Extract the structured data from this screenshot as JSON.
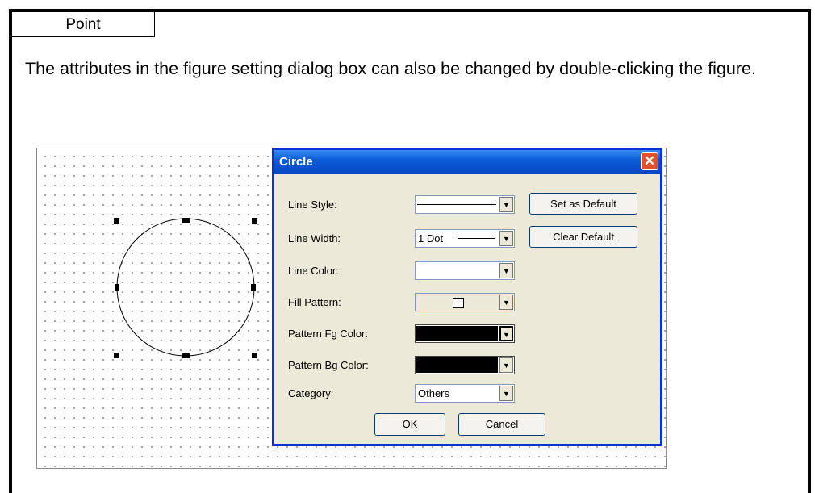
{
  "point_label": "Point",
  "note_text": "The attributes in the figure setting dialog box can also be changed by double-clicking the figure.",
  "dialog": {
    "title": "Circle",
    "close_glyph": "✕",
    "fields": [
      {
        "label": "Line Style:",
        "value": "",
        "kind": "line"
      },
      {
        "label": "Line Width:",
        "value": "1 Dot",
        "kind": "width"
      },
      {
        "label": "Line Color:",
        "value": "",
        "kind": "color",
        "color": "#ffffff"
      },
      {
        "label": "Fill Pattern:",
        "value": "",
        "kind": "pattern"
      },
      {
        "label": "Pattern Fg Color:",
        "value": "",
        "kind": "color",
        "color": "#000000"
      },
      {
        "label": "Pattern Bg Color:",
        "value": "",
        "kind": "color",
        "color": "#000000"
      },
      {
        "label": "Category:",
        "value": "Others",
        "kind": "text"
      }
    ],
    "set_default_label": "Set as Default",
    "clear_default_label": "Clear Default",
    "ok_label": "OK",
    "cancel_label": "Cancel",
    "dropdown_glyph": "▼"
  },
  "colors": {
    "title_bar": "#0a5bd8",
    "dialog_bg": "#ece9d8",
    "close": "#e0502a"
  }
}
